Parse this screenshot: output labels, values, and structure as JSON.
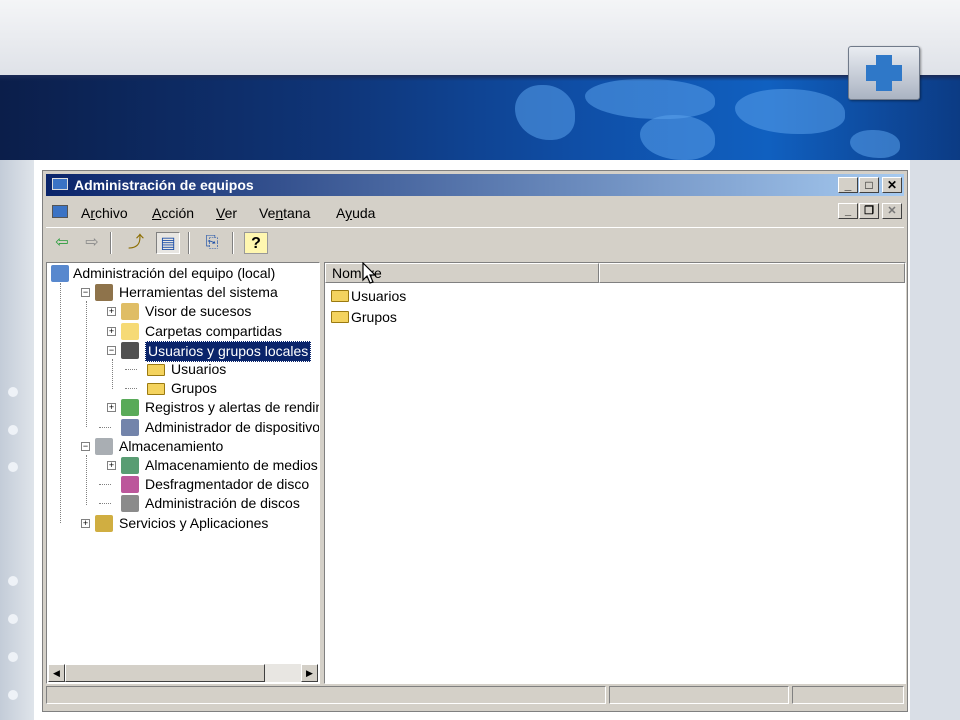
{
  "window": {
    "title": "Administración de equipos",
    "controls": {
      "minimize": "_",
      "maximize": "□",
      "close": "✕"
    }
  },
  "menubar": {
    "items": [
      {
        "label": "Archivo",
        "accel": "r"
      },
      {
        "label": "Acción",
        "accel": "A"
      },
      {
        "label": "Ver",
        "accel": "V"
      },
      {
        "label": "Ventana",
        "accel": "n"
      },
      {
        "label": "Ayuda",
        "accel": "y"
      }
    ],
    "mdi_controls": {
      "minimize": "_",
      "restore": "❐",
      "close": "✕"
    }
  },
  "toolbar": {
    "buttons": [
      "back-arrow-icon",
      "forward-arrow-icon",
      "up-folder-icon",
      "show-tree-icon",
      "export-list-icon",
      "help-icon"
    ],
    "glyphs": {
      "back": "⇦",
      "forward": "⇨",
      "up": "⤴",
      "tree": "▤",
      "export": "⎘",
      "help": "?"
    }
  },
  "tree": {
    "items": [
      {
        "label": "Administración del equipo (local)",
        "level": 0,
        "expander": "",
        "icon": "computer-icon"
      },
      {
        "label": "Herramientas del sistema",
        "level": 1,
        "expander": "−",
        "icon": "tools-icon"
      },
      {
        "label": "Visor de sucesos",
        "level": 2,
        "expander": "+",
        "icon": "event-viewer-icon"
      },
      {
        "label": "Carpetas compartidas",
        "level": 2,
        "expander": "+",
        "icon": "shared-folder-icon"
      },
      {
        "label": "Usuarios y grupos locales",
        "level": 2,
        "expander": "−",
        "icon": "users-groups-icon",
        "selected": true
      },
      {
        "label": "Usuarios",
        "level": 3,
        "expander": "",
        "icon": "folder-icon"
      },
      {
        "label": "Grupos",
        "level": 3,
        "expander": "",
        "icon": "folder-icon"
      },
      {
        "label": "Registros y alertas de rendim",
        "level": 2,
        "expander": "+",
        "icon": "performance-icon"
      },
      {
        "label": "Administrador de dispositivos",
        "level": 2,
        "expander": "",
        "icon": "device-manager-icon"
      },
      {
        "label": "Almacenamiento",
        "level": 1,
        "expander": "−",
        "icon": "storage-icon"
      },
      {
        "label": "Almacenamiento de medios e",
        "level": 2,
        "expander": "+",
        "icon": "removable-storage-icon"
      },
      {
        "label": "Desfragmentador de disco",
        "level": 2,
        "expander": "",
        "icon": "defrag-icon"
      },
      {
        "label": "Administración de discos",
        "level": 2,
        "expander": "",
        "icon": "disk-management-icon"
      },
      {
        "label": "Servicios y Aplicaciones",
        "level": 1,
        "expander": "+",
        "icon": "services-icon"
      }
    ]
  },
  "list": {
    "columns": [
      "Nombre",
      ""
    ],
    "rows": [
      {
        "label": "Usuarios",
        "icon": "folder-icon"
      },
      {
        "label": "Grupos",
        "icon": "folder-icon"
      }
    ]
  },
  "scrollbar": {
    "left": "◀",
    "right": "▶"
  },
  "colors": {
    "title_start": "#0a246a",
    "title_end": "#a6caf0",
    "face": "#d4d0c8",
    "selection": "#0a246a",
    "folder": "#f4d35e"
  }
}
